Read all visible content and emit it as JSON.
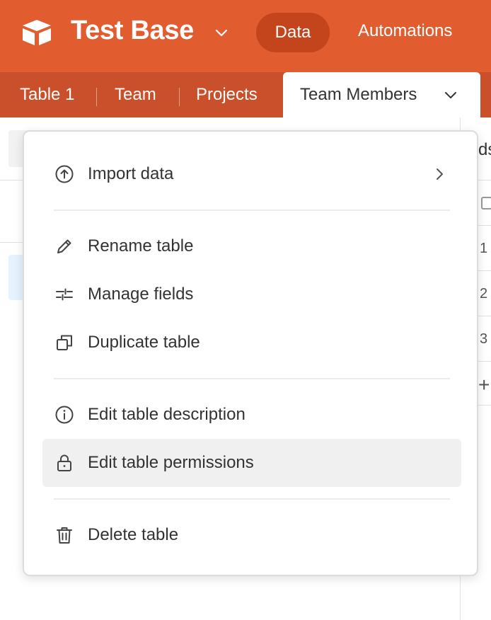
{
  "header": {
    "base_title": "Test Base",
    "nav_data": "Data",
    "nav_automations": "Automations",
    "brand_color": "#e15c2e"
  },
  "tabs": {
    "items": [
      "Table 1",
      "Team",
      "Projects"
    ],
    "active": "Team Members"
  },
  "background": {
    "partial_text": "ds",
    "row_numbers": [
      "1",
      "2",
      "3"
    ],
    "add_symbol": "+"
  },
  "menu": {
    "import_data": "Import data",
    "rename_table": "Rename table",
    "manage_fields": "Manage fields",
    "duplicate_table": "Duplicate table",
    "edit_description": "Edit table description",
    "edit_permissions": "Edit table permissions",
    "delete_table": "Delete table"
  }
}
